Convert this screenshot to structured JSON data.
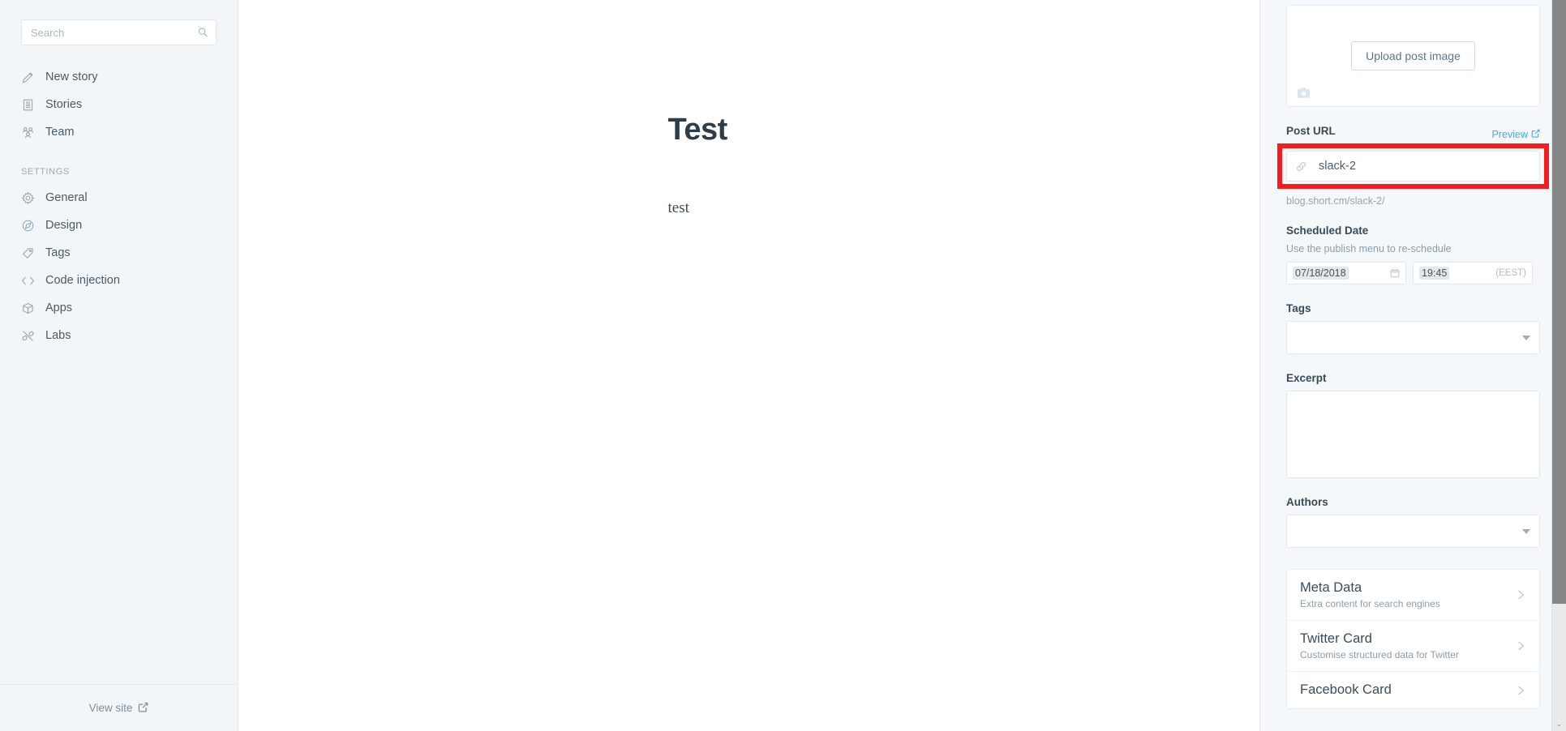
{
  "sidebar": {
    "search": {
      "placeholder": "Search",
      "value": "",
      "icon": "search-icon"
    },
    "primary_items": [
      {
        "label": "New story",
        "icon": "pencil-icon"
      },
      {
        "label": "Stories",
        "icon": "notebook-icon"
      },
      {
        "label": "Team",
        "icon": "team-icon"
      }
    ],
    "settings_heading": "SETTINGS",
    "settings_items": [
      {
        "label": "General",
        "icon": "gear-icon"
      },
      {
        "label": "Design",
        "icon": "compass-icon"
      },
      {
        "label": "Tags",
        "icon": "tag-icon"
      },
      {
        "label": "Code injection",
        "icon": "code-brackets-icon"
      },
      {
        "label": "Apps",
        "icon": "box-icon"
      },
      {
        "label": "Labs",
        "icon": "tools-icon"
      }
    ],
    "footer": {
      "label": "View site",
      "icon": "external-link-icon"
    }
  },
  "editor": {
    "title": "Test",
    "body": "test"
  },
  "panel": {
    "image": {
      "upload_label": "Upload post image",
      "camera_icon": "camera-icon"
    },
    "post_url": {
      "label": "Post URL",
      "preview_label": "Preview",
      "preview_icon": "external-link-icon",
      "link_icon": "chain-link-icon",
      "value": "slack-2",
      "resolved_url": "blog.short.cm/slack-2/",
      "highlight_color": "#f41c1c"
    },
    "scheduled_date": {
      "label": "Scheduled Date",
      "hint": "Use the publish menu to re-schedule",
      "date_value": "07/18/2018",
      "date_icon": "calendar-icon",
      "time_value": "19:45",
      "timezone": "(EEST)"
    },
    "tags": {
      "label": "Tags",
      "value": "",
      "caret_icon": "chevron-down-icon"
    },
    "excerpt": {
      "label": "Excerpt",
      "value": ""
    },
    "authors": {
      "label": "Authors",
      "value": "",
      "caret_icon": "chevron-down-icon"
    },
    "cards": [
      {
        "title": "Meta Data",
        "subtitle": "Extra content for search engines",
        "chevron": "chevron-right-icon"
      },
      {
        "title": "Twitter Card",
        "subtitle": "Customise structured data for Twitter",
        "chevron": "chevron-right-icon"
      },
      {
        "title": "Facebook Card",
        "subtitle": "",
        "chevron": "chevron-right-icon"
      }
    ]
  },
  "scrollbar": {
    "arrow": "⌄"
  },
  "colors": {
    "accent_link": "#3eaaf5",
    "sidebar_bg": "#f2f6f9",
    "panel_bg": "#f4f8fa",
    "text_dark": "#2e3d49",
    "highlight": "#f41c1c"
  }
}
